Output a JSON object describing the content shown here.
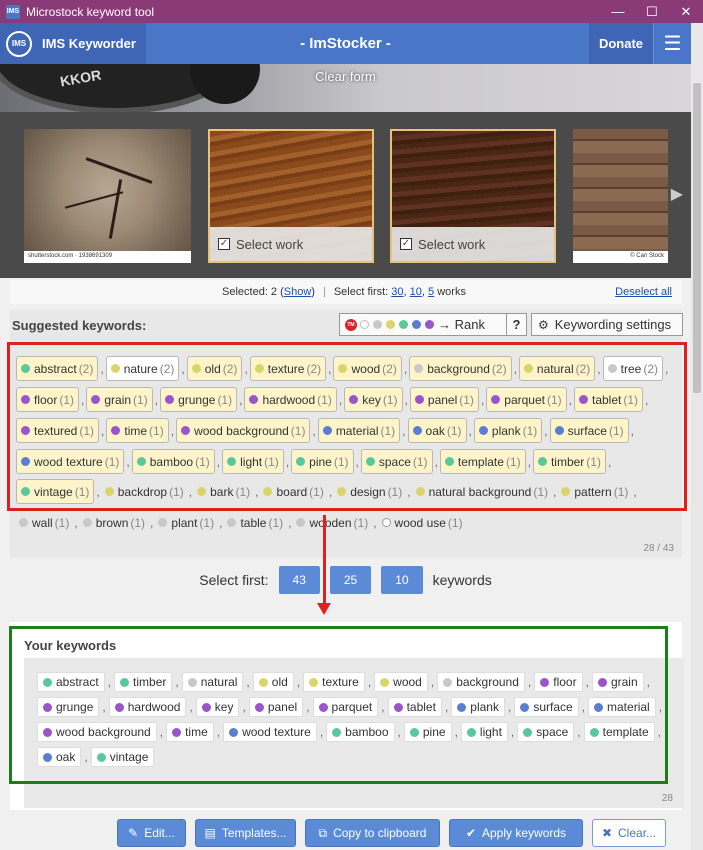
{
  "window": {
    "title": "Microstock keyword tool",
    "app_icon": "IMS",
    "min": "—",
    "max": "☐",
    "close": "✕"
  },
  "nav": {
    "logo": "IMS",
    "brand": "IMS Keyworder",
    "title": "- ImStocker -",
    "donate": "Donate",
    "menu_icon": "hamburger-icon"
  },
  "banner": {
    "lens_text": "KKOR",
    "clear_form": "Clear form"
  },
  "gallery": {
    "items": [
      {
        "credit": "shutterstock.com · 1938691309",
        "selected": false
      },
      {
        "label": "Select work",
        "selected": true
      },
      {
        "label": "Select work",
        "selected": true
      },
      {
        "credit": "© Can Stock",
        "selected": false
      }
    ],
    "next_icon": "▶"
  },
  "selection": {
    "selected_prefix": "Selected: 2 (",
    "show": "Show",
    "selected_suffix": ")",
    "first_label": "Select first:",
    "opt1": "30",
    "opt2": "10",
    "opt3": "5",
    "works": "works",
    "deselect": "Deselect all"
  },
  "suggested": {
    "title": "Suggested keywords:",
    "rank_label": "→ Rank",
    "tm": "TM",
    "help": "?",
    "settings": "Keywording settings",
    "rank_dots": [
      "#ffffff",
      "#c8c8c8",
      "#d9d56a",
      "#5ac89a",
      "#5b7fcf",
      "#9a55c8"
    ],
    "rows": [
      [
        [
          "abstract",
          "(2)",
          "#5ac89a",
          "y"
        ],
        [
          "nature",
          "(2)",
          "#d9d56a",
          "w"
        ],
        [
          "old",
          "(2)",
          "#d9d56a",
          "y"
        ],
        [
          "texture",
          "(2)",
          "#d9d56a",
          "y"
        ],
        [
          "wood",
          "(2)",
          "#d9d56a",
          "y"
        ],
        [
          "background",
          "(2)",
          "#c8c8c8",
          "y"
        ],
        [
          "natural",
          "(2)",
          "#d9d56a",
          "y"
        ],
        [
          "tree",
          "(2)",
          "#c8c8c8",
          "w"
        ]
      ],
      [
        [
          "floor",
          "(1)",
          "#9a55c8",
          "y"
        ],
        [
          "grain",
          "(1)",
          "#9a55c8",
          "y"
        ],
        [
          "grunge",
          "(1)",
          "#9a55c8",
          "y"
        ],
        [
          "hardwood",
          "(1)",
          "#9a55c8",
          "y"
        ],
        [
          "key",
          "(1)",
          "#9a55c8",
          "y"
        ],
        [
          "panel",
          "(1)",
          "#9a55c8",
          "y"
        ],
        [
          "parquet",
          "(1)",
          "#9a55c8",
          "y"
        ],
        [
          "tablet",
          "(1)",
          "#9a55c8",
          "y"
        ]
      ],
      [
        [
          "textured",
          "(1)",
          "#9a55c8",
          "y"
        ],
        [
          "time",
          "(1)",
          "#9a55c8",
          "y"
        ],
        [
          "wood background",
          "(1)",
          "#9a55c8",
          "y"
        ],
        [
          "material",
          "(1)",
          "#5b7fcf",
          "y"
        ],
        [
          "oak",
          "(1)",
          "#5b7fcf",
          "y"
        ],
        [
          "plank",
          "(1)",
          "#5b7fcf",
          "y"
        ],
        [
          "surface",
          "(1)",
          "#5b7fcf",
          "y"
        ]
      ],
      [
        [
          "wood texture",
          "(1)",
          "#5b7fcf",
          "y"
        ],
        [
          "bamboo",
          "(1)",
          "#5ac89a",
          "y"
        ],
        [
          "light",
          "(1)",
          "#5ac89a",
          "y"
        ],
        [
          "pine",
          "(1)",
          "#5ac89a",
          "y"
        ],
        [
          "space",
          "(1)",
          "#5ac89a",
          "y"
        ],
        [
          "template",
          "(1)",
          "#5ac89a",
          "y"
        ],
        [
          "timber",
          "(1)",
          "#5ac89a",
          "y"
        ]
      ],
      [
        [
          "vintage",
          "(1)",
          "#5ac89a",
          "y"
        ],
        [
          "backdrop",
          "(1)",
          "#d9d56a",
          "p"
        ],
        [
          "bark",
          "(1)",
          "#d9d56a",
          "p"
        ],
        [
          "board",
          "(1)",
          "#d9d56a",
          "p"
        ],
        [
          "design",
          "(1)",
          "#d9d56a",
          "p"
        ],
        [
          "natural background",
          "(1)",
          "#d9d56a",
          "p"
        ],
        [
          "pattern",
          "(1)",
          "#d9d56a",
          "p"
        ]
      ],
      [
        [
          "wall",
          "(1)",
          "#c8c8c8",
          "p"
        ],
        [
          "brown",
          "(1)",
          "#c8c8c8",
          "p"
        ],
        [
          "plant",
          "(1)",
          "#c8c8c8",
          "p"
        ],
        [
          "table",
          "(1)",
          "#c8c8c8",
          "p"
        ],
        [
          "wooden",
          "(1)",
          "#c8c8c8",
          "p"
        ],
        [
          "wood use",
          "(1)",
          "#ffffff",
          "p"
        ]
      ]
    ],
    "count": "28 / 43"
  },
  "select_first": {
    "label": "Select first:",
    "b1": "43",
    "b2": "25",
    "b3": "10",
    "suffix": "keywords"
  },
  "your": {
    "title": "Your keywords",
    "rows": [
      [
        [
          "abstract",
          "#5ac89a"
        ],
        [
          "timber",
          "#5ac89a"
        ],
        [
          "natural",
          "#c8c8c8"
        ],
        [
          "old",
          "#d9d56a"
        ],
        [
          "texture",
          "#d9d56a"
        ],
        [
          "wood",
          "#d9d56a"
        ],
        [
          "background",
          "#c8c8c8"
        ],
        [
          "floor",
          "#9a55c8"
        ],
        [
          "grain",
          "#9a55c8"
        ]
      ],
      [
        [
          "grunge",
          "#9a55c8"
        ],
        [
          "hardwood",
          "#9a55c8"
        ],
        [
          "key",
          "#9a55c8"
        ],
        [
          "panel",
          "#9a55c8"
        ],
        [
          "parquet",
          "#9a55c8"
        ],
        [
          "tablet",
          "#9a55c8"
        ],
        [
          "plank",
          "#5b7fcf"
        ],
        [
          "surface",
          "#5b7fcf"
        ],
        [
          "material",
          "#5b7fcf"
        ]
      ],
      [
        [
          "wood background",
          "#9a55c8"
        ],
        [
          "time",
          "#9a55c8"
        ],
        [
          "wood texture",
          "#5b7fcf"
        ],
        [
          "bamboo",
          "#5ac89a"
        ],
        [
          "pine",
          "#5ac89a"
        ],
        [
          "light",
          "#5ac89a"
        ],
        [
          "space",
          "#5ac89a"
        ],
        [
          "template",
          "#5ac89a"
        ]
      ],
      [
        [
          "oak",
          "#5b7fcf"
        ],
        [
          "vintage",
          "#5ac89a"
        ]
      ]
    ],
    "count": "28"
  },
  "actions": {
    "edit": "Edit...",
    "templates": "Templates...",
    "copy": "Copy to clipboard",
    "apply": "Apply keywords",
    "clear": "Clear..."
  }
}
